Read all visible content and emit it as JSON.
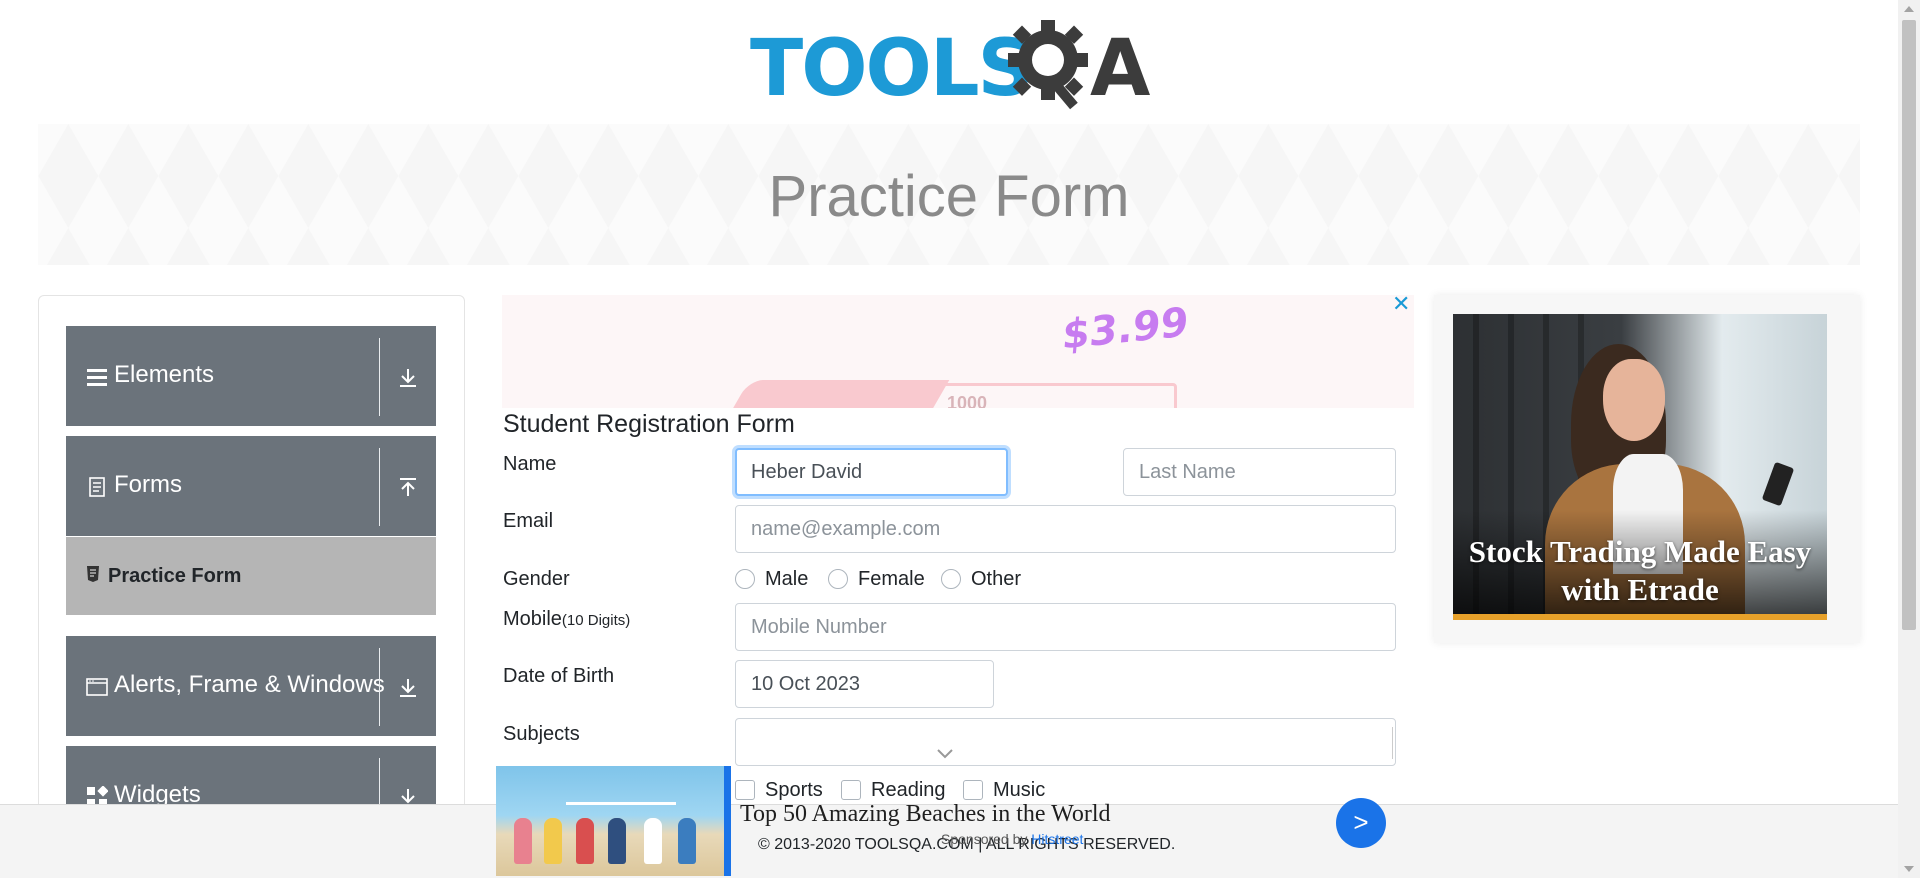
{
  "header": {
    "logo_text": "TOOLS",
    "logo_q": "Q",
    "logo_a": "A"
  },
  "banner": {
    "title": "Practice Form"
  },
  "sidebar": {
    "groups": [
      {
        "label": "Elements",
        "icon": "hamburger-icon",
        "state": "collapsed"
      },
      {
        "label": "Forms",
        "icon": "document-icon",
        "state": "expanded"
      },
      {
        "label": "Alerts, Frame & Windows",
        "icon": "window-icon",
        "state": "collapsed"
      },
      {
        "label": "Widgets",
        "icon": "widgets-icon",
        "state": "collapsed"
      }
    ],
    "active_item": {
      "label": "Practice Form",
      "icon": "form-icon"
    }
  },
  "top_ad": {
    "price": "$3.99",
    "number": "1000",
    "close": "✕"
  },
  "form": {
    "title": "Student Registration Form",
    "name_label": "Name",
    "first_name_value": "Heber David",
    "last_name_placeholder": "Last Name",
    "email_label": "Email",
    "email_placeholder": "name@example.com",
    "gender_label": "Gender",
    "gender_options": [
      "Male",
      "Female",
      "Other"
    ],
    "mobile_label": "Mobile",
    "mobile_hint": "(10 Digits)",
    "mobile_placeholder": "Mobile Number",
    "dob_label": "Date of Birth",
    "dob_value": "10 Oct 2023",
    "subjects_label": "Subjects",
    "hobbies": [
      "Sports",
      "Reading",
      "Music"
    ]
  },
  "right_ad": {
    "headline": "Stock Trading Made Easy with Etrade"
  },
  "bottom_ad": {
    "headline": "Top 50 Amazing Beaches in the World",
    "sponsored_prefix": "Sponsored by ",
    "sponsor": "Hitstreet",
    "go": ">"
  },
  "footer": {
    "text": "© 2013-2020 TOOLSQA.COM | ALL RIGHTS RESERVED."
  },
  "colors": {
    "brand_blue": "#1d9ad6",
    "sidebar_group": "#6b737b",
    "active_item": "#b5b5b5",
    "focus_border": "#80bdff"
  }
}
